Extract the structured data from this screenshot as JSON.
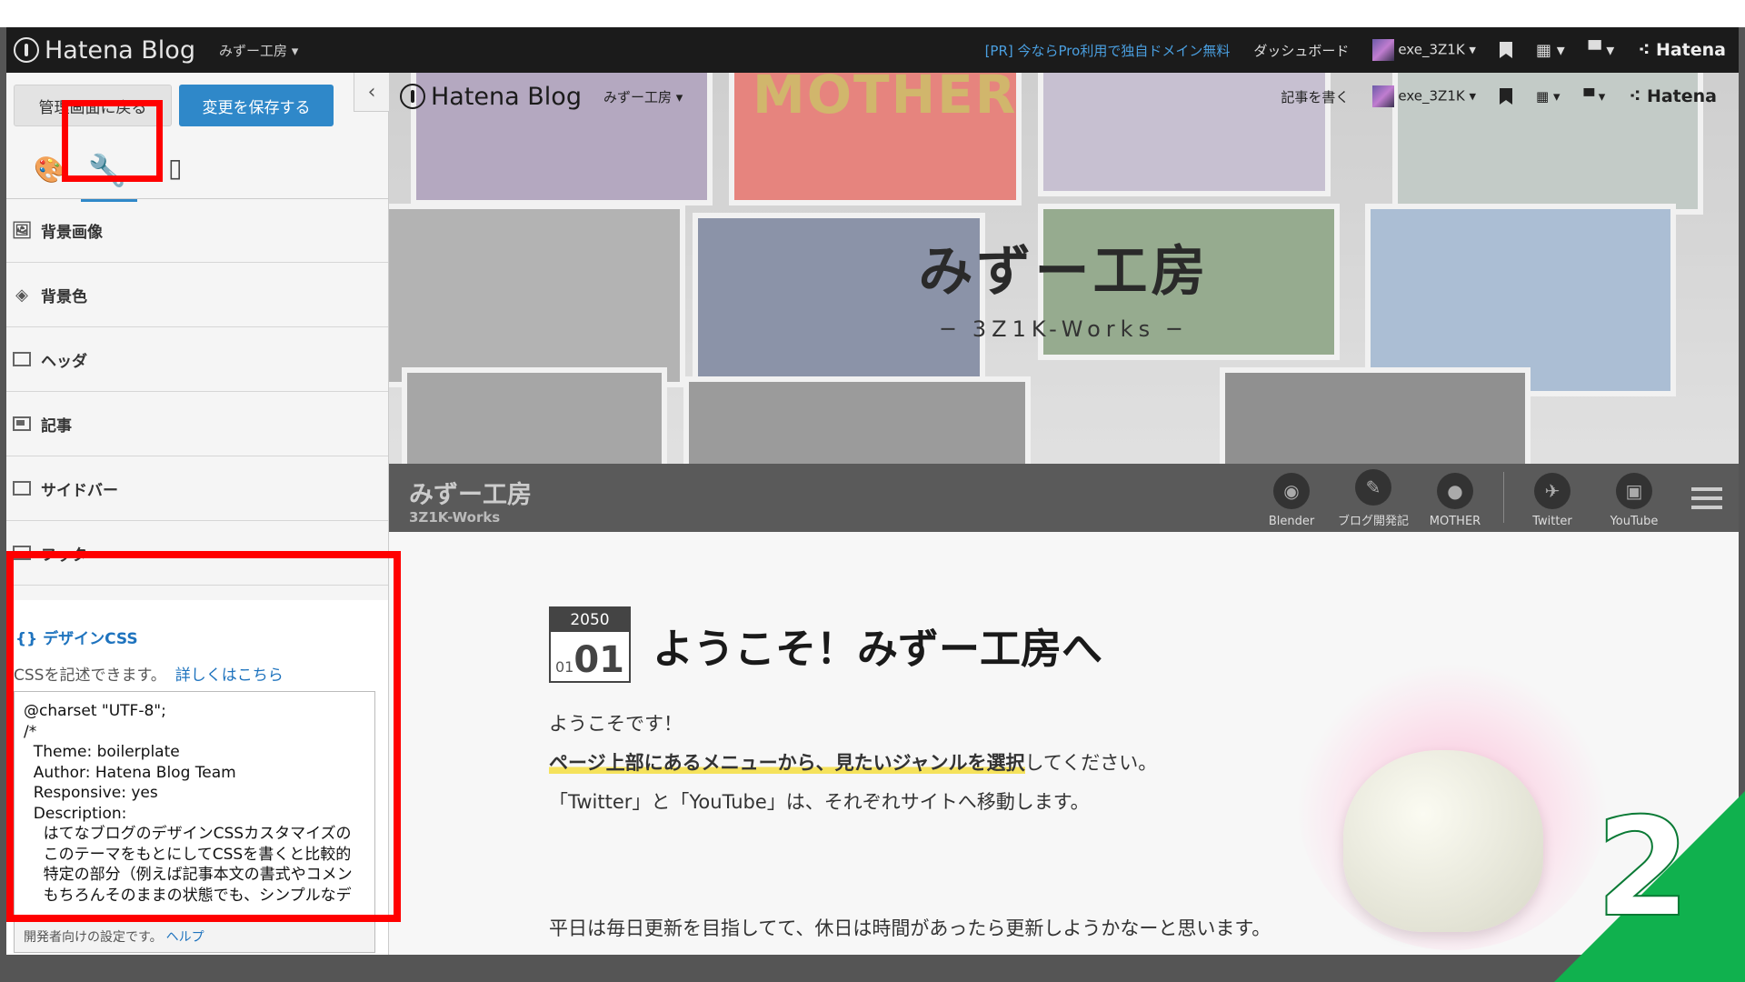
{
  "global_bar": {
    "logo": "Hatena Blog",
    "blog_name": "みずー工房",
    "pr_link": "[PR] 今ならPro利用で独自ドメイン無料",
    "dashboard": "ダッシュボード",
    "user": "exe_3Z1K",
    "brand": "Hatena"
  },
  "panel": {
    "back_button": "管理画面に戻る",
    "save_button": "変更を保存する",
    "collapse": "‹",
    "menu": [
      {
        "label": "背景画像"
      },
      {
        "label": "背景色"
      },
      {
        "label": "ヘッダ"
      },
      {
        "label": "記事"
      },
      {
        "label": "サイドバー"
      },
      {
        "label": "フッタ"
      }
    ],
    "css": {
      "title": "{} デザインCSS",
      "desc": "CSSを記述できます。",
      "desc_link": "詳しくはこちら",
      "code": "@charset \"UTF-8\";\n/*\n  Theme: boilerplate\n  Author: Hatena Blog Team\n  Responsive: yes\n  Description:\n    はてなブログのデザインCSSカスタマイズの\n    このテーマをもとにしてCSSを書くと比較的\n    特定の部分（例えば記事本文の書式やコメン\n    もちろんそのままの状態でも、シンプルなデ",
      "footer": "開発者向けの設定です。",
      "footer_link": "ヘルプ"
    }
  },
  "preview": {
    "bar": {
      "logo": "Hatena Blog",
      "blog_name": "みずー工房",
      "write": "記事を書く",
      "user": "exe_3Z1K",
      "brand": "Hatena"
    },
    "header": {
      "title": "みずー工房",
      "subtitle": "─ 3Z1K-Works ─",
      "banner_text": "MOTHER"
    },
    "nav": {
      "title": "みずー工房",
      "subtitle": "3Z1K-Works",
      "items": [
        {
          "label": "Blender"
        },
        {
          "label": "ブログ開発記"
        },
        {
          "label": "MOTHER"
        },
        {
          "label": "Twitter"
        },
        {
          "label": "YouTube"
        }
      ]
    },
    "article": {
      "year": "2050",
      "month": "01",
      "day": "01",
      "title": "ようこそ！みずー工房へ",
      "p1": "ようこそです！",
      "p2_em": "ページ上部にあるメニューから、見たいジャンルを選択",
      "p2_rest": "してください。",
      "p3": "「Twitter」と「YouTube」は、それぞれサイトへ移動します。",
      "p4": "平日は毎日更新を目指してて、休日は時間があったら更新しようかなーと思います。"
    }
  },
  "step_badge": "2",
  "colors": {
    "accent": "#2f88c9",
    "highlight": "#ff0000",
    "badge": "#10b14e"
  }
}
